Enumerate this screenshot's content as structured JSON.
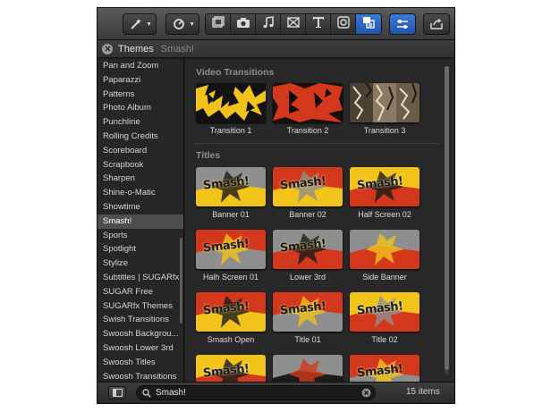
{
  "header": {
    "title": "Themes",
    "current": "Smash!"
  },
  "toolbar": {
    "buttons": [
      "magic-wand-icon",
      "retime-icon",
      "clips-icon",
      "camera-icon",
      "music-icon",
      "transitions-icon",
      "title-icon",
      "generator-icon",
      "themes-icon",
      "inspector-icon",
      "share-icon"
    ],
    "active": "themes-icon"
  },
  "sidebar": {
    "items": [
      {
        "label": "Pan and Zoom"
      },
      {
        "label": "Paparazzi"
      },
      {
        "label": "Patterns"
      },
      {
        "label": "Photo Album"
      },
      {
        "label": "Punchline"
      },
      {
        "label": "Rolling Credits"
      },
      {
        "label": "Scoreboard"
      },
      {
        "label": "Scrapbook"
      },
      {
        "label": "Sharpen"
      },
      {
        "label": "Shine-o-Matic"
      },
      {
        "label": "Showtime"
      },
      {
        "label": "Smash!",
        "selected": true
      },
      {
        "label": "Sports"
      },
      {
        "label": "Spotlight"
      },
      {
        "label": "Stylize"
      },
      {
        "label": "Subtitles | SUGARfx"
      },
      {
        "label": "SUGAR Free"
      },
      {
        "label": "SUGARfx Themes"
      },
      {
        "label": "Swish Transitions"
      },
      {
        "label": "Swoosh Backgrou..."
      },
      {
        "label": "Swoosh Lower 3rd"
      },
      {
        "label": "Swoosh Titles"
      },
      {
        "label": "Swoosh Transitions"
      }
    ]
  },
  "content": {
    "sections": [
      {
        "title": "Video Transitions",
        "items": [
          {
            "label": "Transition 1"
          },
          {
            "label": "Transition 2"
          },
          {
            "label": "Transition 3"
          }
        ]
      },
      {
        "title": "Titles",
        "items": [
          {
            "label": "Banner 01",
            "thumb_text": "Smash!"
          },
          {
            "label": "Banner 02",
            "thumb_text": "Smash!"
          },
          {
            "label": "Half Screen 02",
            "thumb_text": "Smash!"
          },
          {
            "label": "Halh Screen 01",
            "thumb_text": "Smash!"
          },
          {
            "label": "Lower 3rd",
            "thumb_text": "Smash!"
          },
          {
            "label": "Side Banner",
            "thumb_text": ""
          },
          {
            "label": "Smash Open",
            "thumb_text": "Smash!"
          },
          {
            "label": "Title 01",
            "thumb_text": "Smash!"
          },
          {
            "label": "Title 02",
            "thumb_text": "Smash!"
          },
          {
            "label": "",
            "thumb_text": "Smash!"
          },
          {
            "label": "",
            "thumb_text": ""
          },
          {
            "label": "",
            "thumb_text": "Smash!"
          }
        ]
      }
    ]
  },
  "bottom": {
    "search_value": "Smash!",
    "item_count": "15 items"
  },
  "colors": {
    "accent": "#2f67c4",
    "smash_yellow": "#f2c318",
    "smash_red": "#d4381c",
    "smash_grey": "#8e8e8e",
    "dark_bg": "#282828"
  }
}
